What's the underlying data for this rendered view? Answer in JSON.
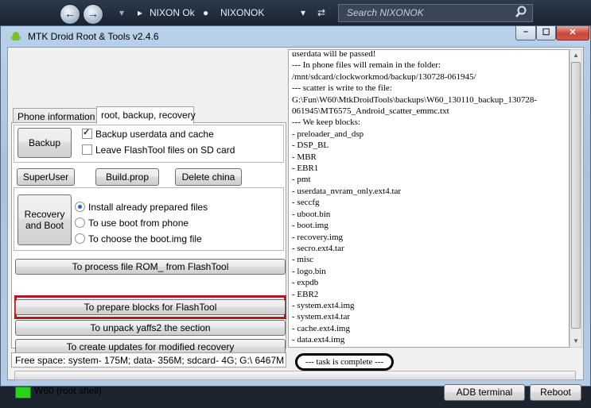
{
  "explorer": {
    "crumbs": [
      "NIXON Ok",
      "NIXONOK"
    ],
    "search_placeholder": "Search NIXONOK"
  },
  "window": {
    "title": "MTK Droid Root & Tools v2.4.6",
    "minimize": "–",
    "maximize": "☐",
    "close": "✕"
  },
  "tabs": [
    {
      "label": "Phone information",
      "active": false
    },
    {
      "label": "root, backup, recovery",
      "active": true
    }
  ],
  "backup_group": {
    "backup_button": "Backup",
    "chk_backup_userdata": {
      "label": "Backup userdata and cache",
      "checked": true
    },
    "chk_leave_flashtool": {
      "label": "Leave FlashTool files on SD card",
      "checked": false
    }
  },
  "tools_row": {
    "superuser": "SuperUser",
    "buildprop": "Build.prop",
    "delete_china": "Delete china"
  },
  "recovery_group": {
    "button": [
      "Recovery",
      "and Boot"
    ],
    "options": [
      {
        "label": "Install already prepared files",
        "selected": true
      },
      {
        "label": "To use boot from phone",
        "selected": false
      },
      {
        "label": "To choose the boot.img file",
        "selected": false
      }
    ]
  },
  "actions": {
    "process_rom": "To process file ROM_ from FlashTool",
    "prepare_blocks": "To prepare blocks for FlashTool",
    "unpack_yaffs": "To unpack yaffs2 the section",
    "create_updates": "To create updates for modified recovery"
  },
  "free_space": "Free space: system- 175M; data- 356M; sdcard- 4G;  G:\\ 6467M",
  "log": [
    "userdata will be passed!",
    " --- In phone files will remain in the folder:",
    "/mnt/sdcard/clockworkmod/backup/130728-061945/",
    " --- scatter is write to the file:",
    "G:\\Fun\\W60\\MtkDroidTools\\backups\\W60_130110_backup_130728-",
    "061945\\MT6575_Android_scatter_emmc.txt",
    " --- We keep blocks:",
    " - preloader_and_dsp",
    " - DSP_BL",
    " - MBR",
    " - EBR1",
    " - pmt",
    " - userdata_nvram_only.ext4.tar",
    " - seccfg",
    " - uboot.bin",
    " - boot.img",
    " - recovery.img",
    " - secro.ext4.tar",
    " - misc",
    " - logo.bin",
    " - expdb",
    " - EBR2",
    " - system.ext4.img",
    " - system.ext4.tar",
    " - cache.ext4.img",
    " - data.ext4.img"
  ],
  "task_status": "--- task is complete  ---",
  "progress_fraction": 0,
  "status": {
    "indicator_color": "#2ad21e",
    "text": "W60 (root shell)"
  },
  "bottom_buttons": {
    "adb_terminal": "ADB terminal",
    "reboot": "Reboot"
  },
  "colors": {
    "highlight_frame": "#b0191f"
  }
}
